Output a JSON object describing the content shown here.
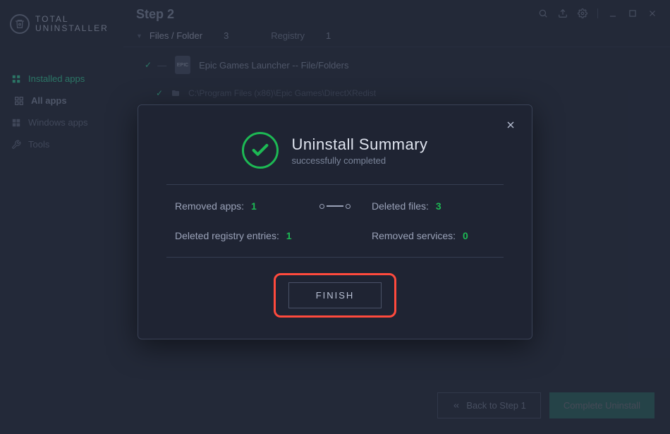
{
  "app": {
    "name_line1": "TOTAL",
    "name_line2": "UNINSTALLER"
  },
  "sidebar": {
    "items": [
      {
        "label": "Installed apps",
        "icon": "apps-icon"
      },
      {
        "label": "All apps",
        "icon": "grid-icon"
      },
      {
        "label": "Windows apps",
        "icon": "windows-icon"
      },
      {
        "label": "Tools",
        "icon": "wrench-icon"
      }
    ]
  },
  "header": {
    "step_label": "Step 2"
  },
  "tabs": {
    "files": {
      "label": "Files / Folder",
      "count": "3"
    },
    "registry": {
      "label": "Registry",
      "count": "1"
    }
  },
  "content": {
    "app_name": "Epic Games Launcher -- File/Folders",
    "badge": "EPIC",
    "file_path": "C:\\Program Files (x86)\\Epic Games\\DirectXRedist"
  },
  "bottom": {
    "back_label": "Back to Step 1",
    "complete_label": "Complete Uninstall"
  },
  "modal": {
    "title": "Uninstall Summary",
    "subtitle": "successfully completed",
    "removed_apps_label": "Removed apps:",
    "removed_apps_value": "1",
    "deleted_files_label": "Deleted files:",
    "deleted_files_value": "3",
    "deleted_registry_label": "Deleted registry entries:",
    "deleted_registry_value": "1",
    "removed_services_label": "Removed services:",
    "removed_services_value": "0",
    "finish_label": "FINISH"
  }
}
